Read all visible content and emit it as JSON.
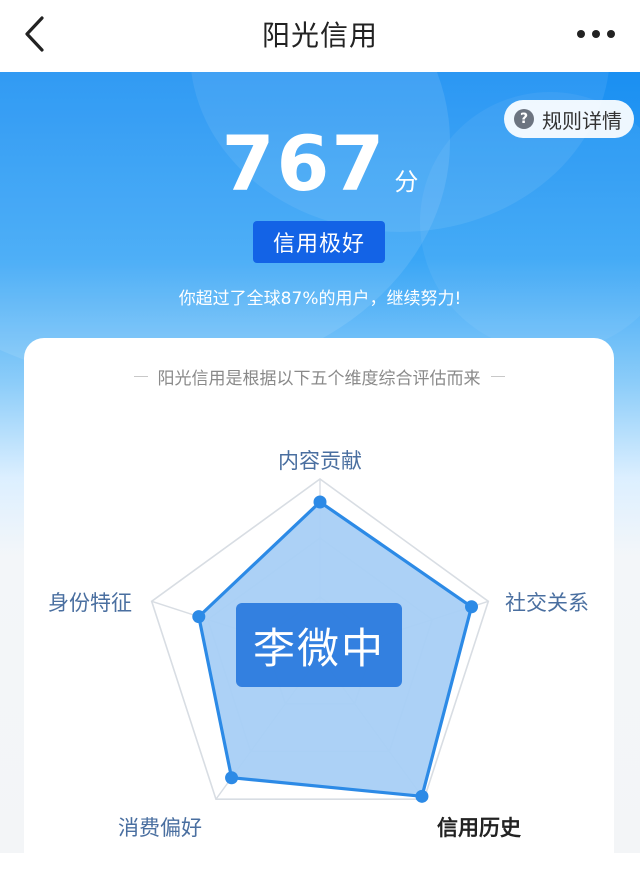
{
  "header": {
    "title": "阳光信用",
    "back_icon": "chevron-left-icon",
    "more_icon": "more-horizontal-icon"
  },
  "hero": {
    "rules_label": "规则详情",
    "rules_icon": "question-circle-icon",
    "score": "767",
    "score_unit": "分",
    "level": "信用极好",
    "rank_text": "你超过了全球87%的用户，继续努力!"
  },
  "radar": {
    "subtitle": "阳光信用是根据以下五个维度综合评估而来",
    "dimensions": [
      {
        "label": "内容贡献",
        "value": 0.87,
        "highlight": false
      },
      {
        "label": "社交关系",
        "value": 0.9,
        "highlight": false
      },
      {
        "label": "信用历史",
        "value": 0.98,
        "highlight": true
      },
      {
        "label": "消费偏好",
        "value": 0.85,
        "highlight": false
      },
      {
        "label": "身份特征",
        "value": 0.72,
        "highlight": false
      }
    ],
    "fill_color": "#a8cff5",
    "stroke_color": "#2c8ae6",
    "grid_color": "#d8dde3"
  },
  "watermark": "李微中"
}
